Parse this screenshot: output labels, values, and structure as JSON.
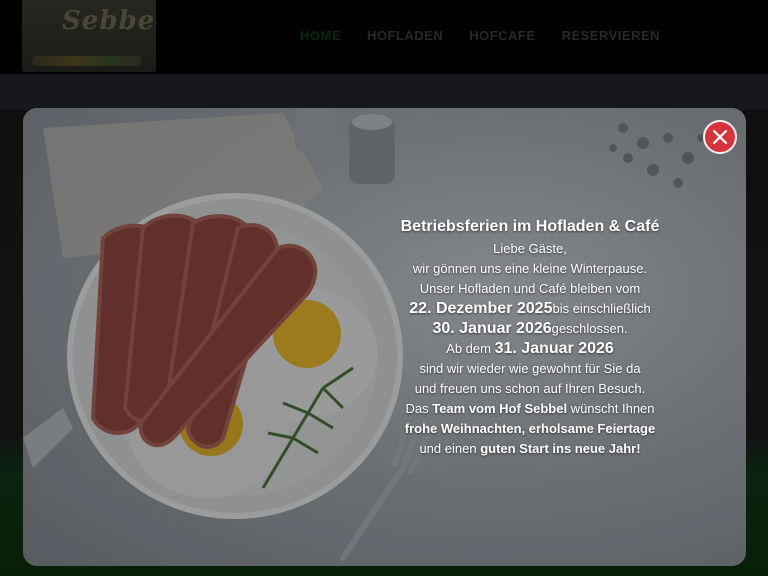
{
  "header": {
    "logo_text": "Sebbel",
    "nav": [
      "HOME",
      "HOFLADEN",
      "HOFCAFE",
      "RESERVIEREN"
    ]
  },
  "modal": {
    "title": "Betriebsferien im Hofladen & Café",
    "greeting": "Liebe Gäste,",
    "line1": "wir gönnen uns eine kleine Winterpause.",
    "line2": "Unser Hofladen und Café bleiben vom",
    "date_start": "22. Dezember 2025",
    "date_start_suffix": "bis einschließlich",
    "date_end": "30. Januar 2026",
    "date_end_suffix": "geschlossen.",
    "reopen_prefix": "Ab dem",
    "reopen_date": "31. Januar 2026",
    "line3": "sind wir wieder wie gewohnt für Sie da",
    "line4": "und freuen uns schon auf Ihren Besuch.",
    "line5_prefix": "Das",
    "team": "Team vom Hof Sebbel",
    "line5_suffix": "wünscht Ihnen",
    "wishes": "frohe Weihnachten, erholsame Feiertage",
    "line6_prefix": "und einen",
    "start": "guten Start ins neue Jahr!"
  },
  "colors": {
    "close": "#d8333b",
    "header": "#020202",
    "nav_active": "#0d2a14"
  },
  "icons": {
    "close": "close-icon"
  }
}
